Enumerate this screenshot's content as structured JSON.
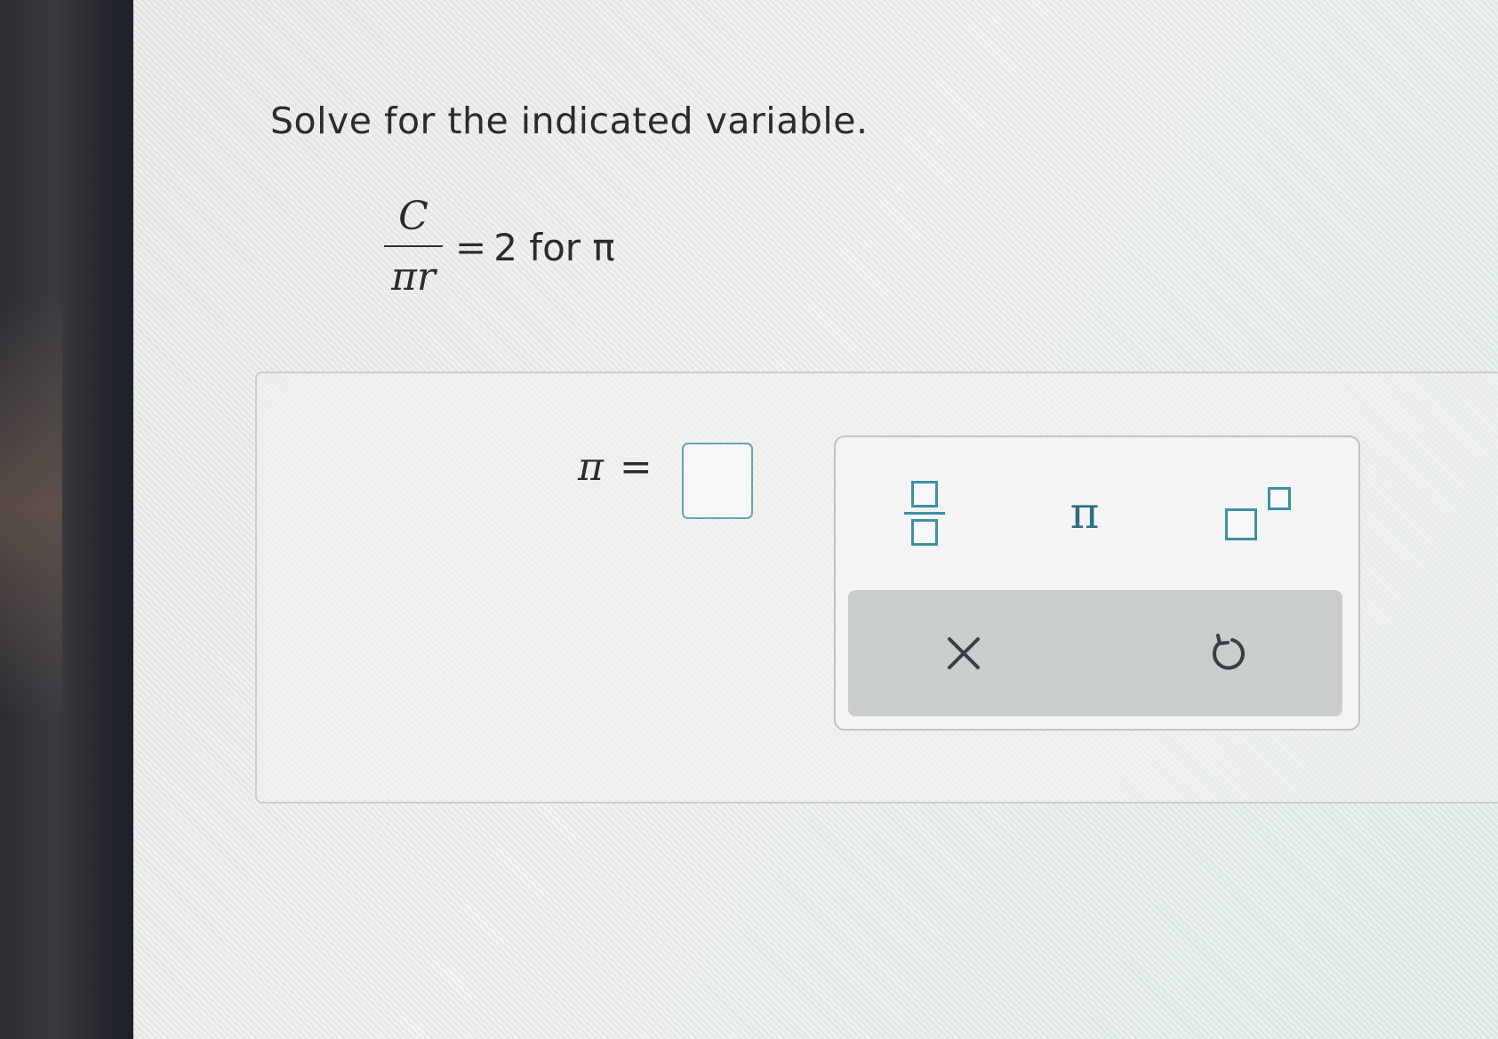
{
  "question": {
    "instruction": "Solve for the indicated variable.",
    "equation": {
      "numerator": "C",
      "denominator": "πr",
      "equals": "=",
      "rhs": "2",
      "for_word": "for",
      "variable": "π"
    }
  },
  "answer": {
    "lhs": "π",
    "equals": "=",
    "value": ""
  },
  "keypad": {
    "keys": [
      {
        "name": "fraction-button",
        "icon": "fraction-icon"
      },
      {
        "name": "pi-button",
        "label": "π",
        "icon": "pi-icon"
      },
      {
        "name": "exponent-button",
        "icon": "exponent-icon"
      }
    ],
    "actions": [
      {
        "name": "clear-button",
        "icon": "x-icon"
      },
      {
        "name": "undo-button",
        "icon": "undo-icon"
      }
    ]
  },
  "colors": {
    "accent": "#3f8fa3",
    "input_border": "#6aa1b6",
    "action_bar": "#c9cdcb",
    "text": "#2b2b2b"
  }
}
